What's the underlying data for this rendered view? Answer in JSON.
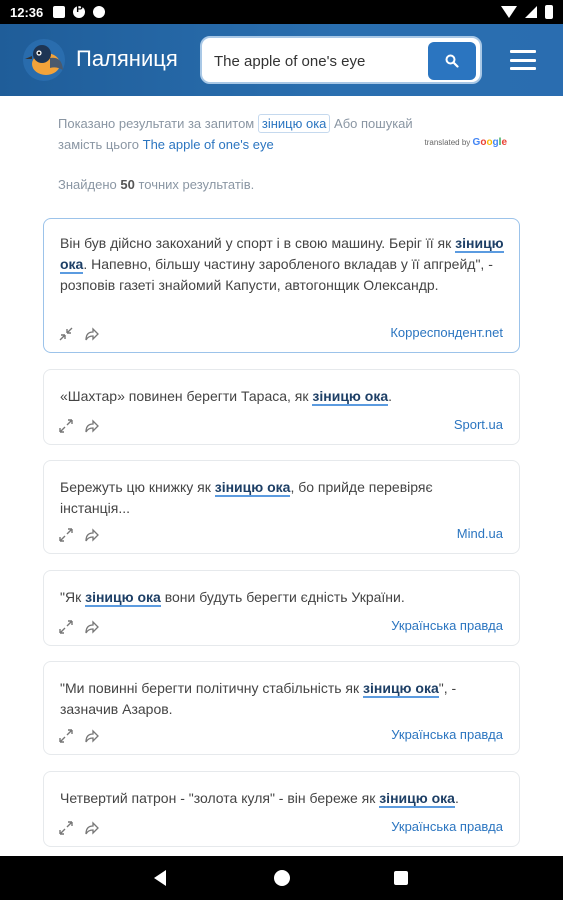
{
  "status_bar": {
    "time": "12:36"
  },
  "header": {
    "title": "Паляниця",
    "search_value": "The apple of one's eye"
  },
  "notice": {
    "prefix": "Показано результати за запитом",
    "query": "зіницю ока",
    "middle": "Або пошукай",
    "line2_prefix": "замість цього",
    "alt_query": "The apple of one's eye",
    "translated_by": "translated by",
    "google": "Google"
  },
  "results_count": {
    "prefix": "Знайдено",
    "number": "50",
    "suffix": "точних результатів."
  },
  "cards": [
    {
      "before": "Він був дійсно закоханий у спорт і в свою машину. Беріг її як ",
      "highlight": "зіницю ока",
      "after": ". Напевно, більшу частину заробленого вкладав у її апгрейд\", - розповів газеті знайомий Капусти, автогонщик Олександр.",
      "source": "Корреспондент.net"
    },
    {
      "before": "«Шахтар» повинен берегти Тараса, як ",
      "highlight": "зіницю ока",
      "after": ".",
      "source": "Sport.ua"
    },
    {
      "before": "Бережуть цю книжку як ",
      "highlight": "зіницю ока",
      "after": ", бо прийде перевіряє інстанція...",
      "source": "Mind.ua"
    },
    {
      "before": "\"Як ",
      "highlight": "зіницю ока",
      "after": " вони будуть берегти єдність України.",
      "source": "Українська правда"
    },
    {
      "before": "\"Ми повинні берегти політичну стабільність як ",
      "highlight": "зіницю ока",
      "after": "\", - зазначив Азаров.",
      "source": "Українська правда"
    },
    {
      "before": "Четвертий патрон - \"золота куля\" - він береже як ",
      "highlight": "зіницю ока",
      "after": ".",
      "source": "Українська правда"
    }
  ],
  "icons": {
    "search": "search-icon",
    "menu": "hamburger-menu-icon",
    "expand": "expand-icon",
    "collapse": "collapse-icon",
    "share": "share-icon"
  },
  "colors": {
    "header": "#2a6db0",
    "accent": "#2b75c0",
    "highlight_underline": "#5b9be0"
  }
}
